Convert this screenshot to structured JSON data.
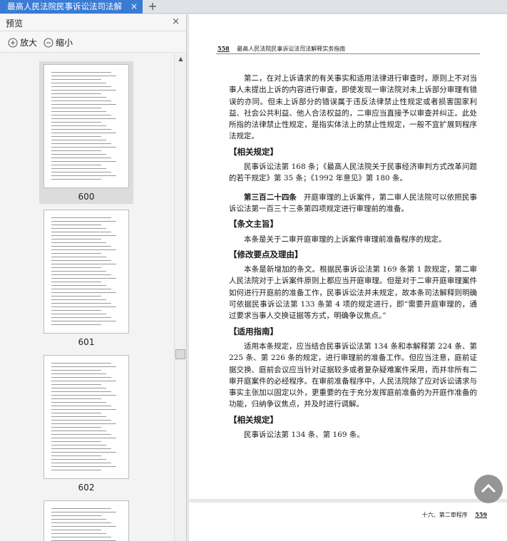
{
  "tab": {
    "title": "最高人民法院民事诉讼法司法解",
    "close": "×",
    "add": "+"
  },
  "sidebar": {
    "title": "预览",
    "close": "×",
    "zoom_in": "放大",
    "zoom_out": "缩小",
    "scroll_up": "▲",
    "thumbnails": [
      {
        "page": "600",
        "selected": true
      },
      {
        "page": "601",
        "selected": false
      },
      {
        "page": "602",
        "selected": false
      },
      {
        "page": "",
        "selected": false
      }
    ]
  },
  "document": {
    "page_number": "558",
    "header_title": "最高人民法院民事诉讼法司法解释实务指南",
    "para1": "第二，在对上诉请求的有关事实和适用法律进行审查时，原则上不对当事人未提出上诉的内容进行审查，即使发现一审法院对未上诉部分审理有错误的亦同。但未上诉部分的错误属于违反法律禁止性规定或者损害国家利益、社会公共利益、他人合法权益的，二审应当直接予以审查并纠正。此处所指的法律禁止性规定，是指实体法上的禁止性规定，一般不宜扩展到程序法规定。",
    "h_related1": "【相关规定】",
    "related1": "民事诉讼法第 168 条；《最高人民法院关于民事经济审判方式改革问题的若干规定》第 35 条；《1992 年意见》第 180 条。",
    "article_no": "第三百二十四条",
    "article_text": "开庭审理的上诉案件，第二审人民法院可以依照民事诉讼法第一百三十三条第四项规定进行审理前的准备。",
    "h_gist": "【条文主旨】",
    "gist": "本条是关于二审开庭审理的上诉案件审理前准备程序的规定。",
    "h_reason": "【修改要点及理由】",
    "reason": "本条是新增加的条文。根据民事诉讼法第 169 条第 1 款规定，第二审人民法院对于上诉案件原则上都应当开庭审理。但是对于二审开庭审理案件如何进行开庭前的准备工作，民事诉讼法并未规定，故本条司法解释则明确可依据民事诉讼法第 133 条第 4 项的规定进行，即“需要开庭审理的，通过要求当事人交换证据等方式，明确争议焦点。”",
    "h_guide": "【适用指南】",
    "guide": "适用本条规定，应当结合民事诉讼法第 134 条和本解释第 224 条、第 225 条、第 226 条的规定，进行审理前的准备工作。但应当注意，庭前证据交换、庭前会议应当针对证据较多或者复杂疑难案件采用，而并非所有二审开庭案件的必经程序。在审前准备程序中，人民法院除了应对诉讼请求与事实主张加以固定以外，更重要的在于充分发挥庭前准备的为开庭作准备的功能，归纳争议焦点，并及时进行调解。",
    "h_related2": "【相关规定】",
    "related2": "民事诉讼法第 134 条、第 169 条。",
    "next_footer": "十六、第二审程序",
    "next_page_number": "559"
  },
  "icons": {
    "zoom_in": "zoom-in-icon",
    "zoom_out": "zoom-out-icon",
    "back_to_top": "chevron-up-icon"
  },
  "colors": {
    "tab_active": "#3a7bd5",
    "back_to_top": "#8a8a8a"
  }
}
